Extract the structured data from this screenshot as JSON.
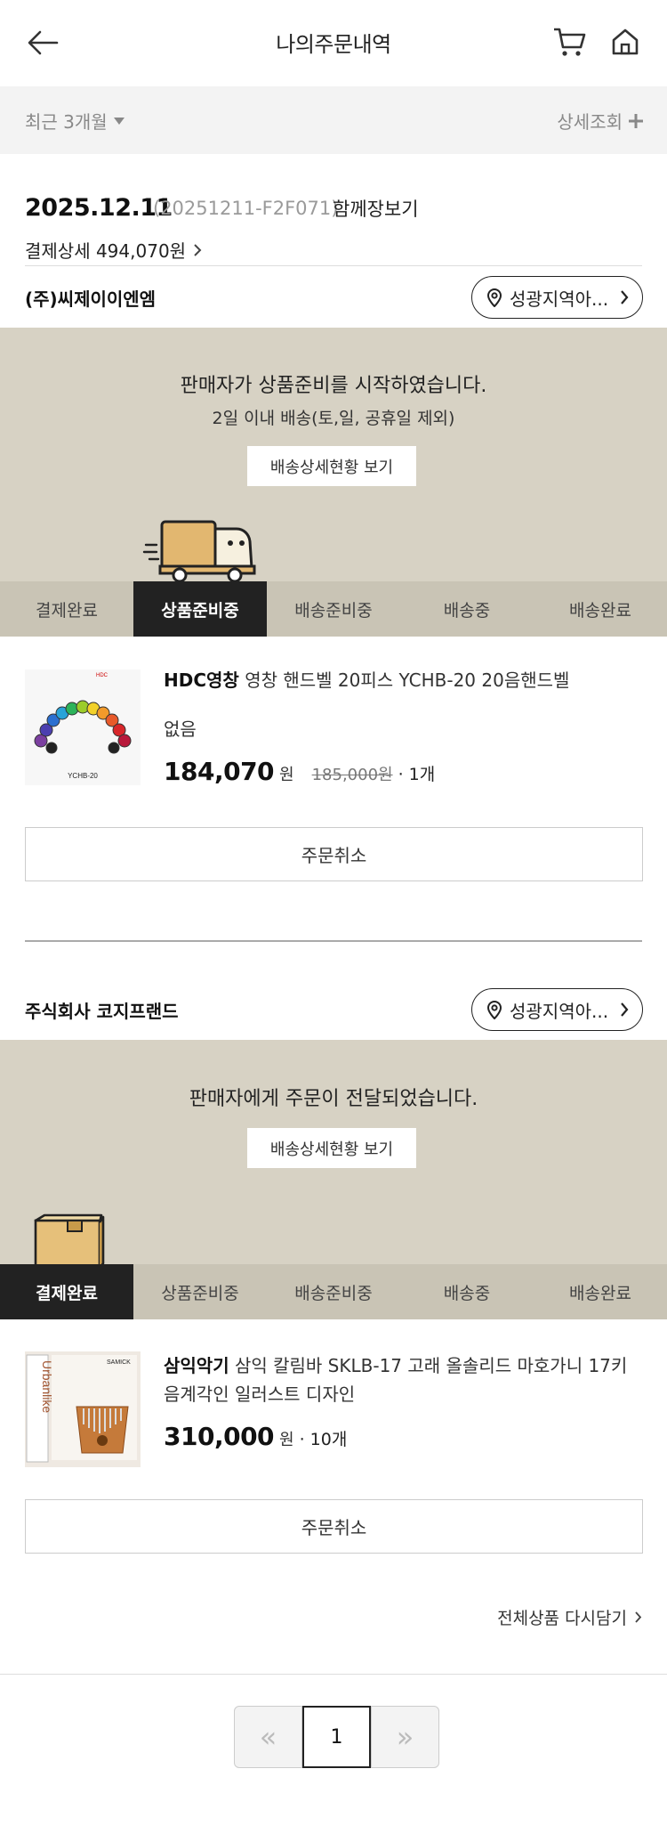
{
  "header": {
    "title": "나의주문내역"
  },
  "filter": {
    "period": "최근 3개월",
    "detail": "상세조회"
  },
  "order": {
    "date": "2025.12.11",
    "order_no": "(20251211-F2F071)",
    "together": "함께장보기",
    "pay_detail": "결제상세 494,070원"
  },
  "shipments": [
    {
      "seller": "(주)씨제이이엔엠",
      "location": "성광지역아...",
      "message": "판매자가 상품준비를 시작하였습니다.",
      "sub_message": "2일 이내 배송(토,일, 공휴일 제외)",
      "track_label": "배송상세현황 보기",
      "steps": [
        "결제완료",
        "상품준비중",
        "배송준비중",
        "배송중",
        "배송완료"
      ],
      "active_step": 1,
      "product": {
        "brand": "HDC영창",
        "name": "영창 핸드벨 20피스 YCHB-20 20음핸드벨",
        "option": "없음",
        "price": "184,070",
        "won": "원",
        "original": "185,000원",
        "qty": "· 1개",
        "thumb_label": "YCHB-20",
        "thumb_brand": "HDC"
      },
      "cancel_label": "주문취소"
    },
    {
      "seller": "주식회사 코지프랜드",
      "location": "성광지역아...",
      "message": "판매자에게 주문이 전달되었습니다.",
      "track_label": "배송상세현황 보기",
      "steps": [
        "결제완료",
        "상품준비중",
        "배송준비중",
        "배송중",
        "배송완료"
      ],
      "active_step": 0,
      "product": {
        "brand": "삼익악기",
        "name": "삼익 칼림바 SKLB-17 고래 올솔리드 마호가니 17키 음계각인 일러스트 디자인",
        "price": "310,000",
        "won": "원",
        "qty": "· 10개",
        "thumb_text": "Urbanlike",
        "thumb_brand": "SAMICK"
      },
      "cancel_label": "주문취소"
    }
  ],
  "reorder_label": "전체상품 다시담기",
  "pagination": {
    "prev": "«",
    "current": "1",
    "next": "»"
  },
  "colors": {
    "banner": "#d7d2c4",
    "steps_bg": "#c9c4b5",
    "active_step": "#222222"
  },
  "icons": [
    "back-arrow-icon",
    "cart-icon",
    "home-icon",
    "caret-down-icon",
    "plus-icon",
    "chevron-right-icon",
    "location-pin-icon",
    "truck-icon",
    "box-icon"
  ]
}
